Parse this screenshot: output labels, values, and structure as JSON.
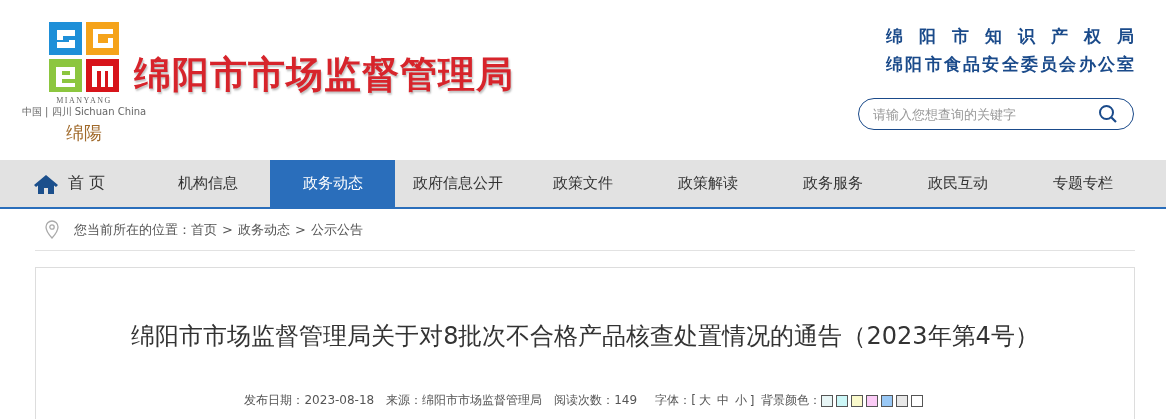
{
  "header": {
    "logo": {
      "latin": "MIANYANG",
      "subtitle": "中国 | 四川 Sichuan China",
      "calligraphy": "绵陽"
    },
    "site_title": "绵阳市市场监督管理局",
    "agencies": [
      "绵 阳 市 知 识 产 权 局",
      "绵阳市食品安全委员会办公室"
    ],
    "search": {
      "placeholder": "请输入您想查询的关键字"
    }
  },
  "nav": [
    {
      "label": "首 页",
      "kind": "home",
      "selected": false
    },
    {
      "label": "机构信息",
      "kind": "link",
      "selected": false
    },
    {
      "label": "政务动态",
      "kind": "link",
      "selected": true
    },
    {
      "label": "政府信息公开",
      "kind": "link",
      "selected": false
    },
    {
      "label": "政策文件",
      "kind": "link",
      "selected": false
    },
    {
      "label": "政策解读",
      "kind": "link",
      "selected": false
    },
    {
      "label": "政务服务",
      "kind": "link",
      "selected": false
    },
    {
      "label": "政民互动",
      "kind": "link",
      "selected": false
    },
    {
      "label": "专题专栏",
      "kind": "link",
      "selected": false
    }
  ],
  "breadcrumb": {
    "prefix": "您当前所在的位置：",
    "items": [
      "首页",
      "政务动态",
      "公示公告"
    ],
    "separator": ">"
  },
  "article": {
    "title": "绵阳市市场监督管理局关于对8批次不合格产品核查处置情况的通告（2023年第4号）",
    "meta": [
      {
        "label": "发布日期：",
        "value": "2023-08-18"
      },
      {
        "label": "来源：",
        "value": "绵阳市市场监督管理局"
      },
      {
        "label": "阅读次数：",
        "value": "149"
      }
    ],
    "font_size": {
      "label": "字体：",
      "open": "[",
      "options": [
        "大",
        "中",
        "小"
      ],
      "close": "]"
    },
    "background": {
      "label": "背景颜色：",
      "swatches": [
        {
          "color": "#e8f6f6"
        },
        {
          "color": "#ccf7f7"
        },
        {
          "color": "#fafacc"
        },
        {
          "color": "#fbccf6"
        },
        {
          "color": "#99c8f5"
        },
        {
          "color": "#e8e8e8"
        },
        {
          "color": "#ffffff"
        }
      ]
    }
  }
}
